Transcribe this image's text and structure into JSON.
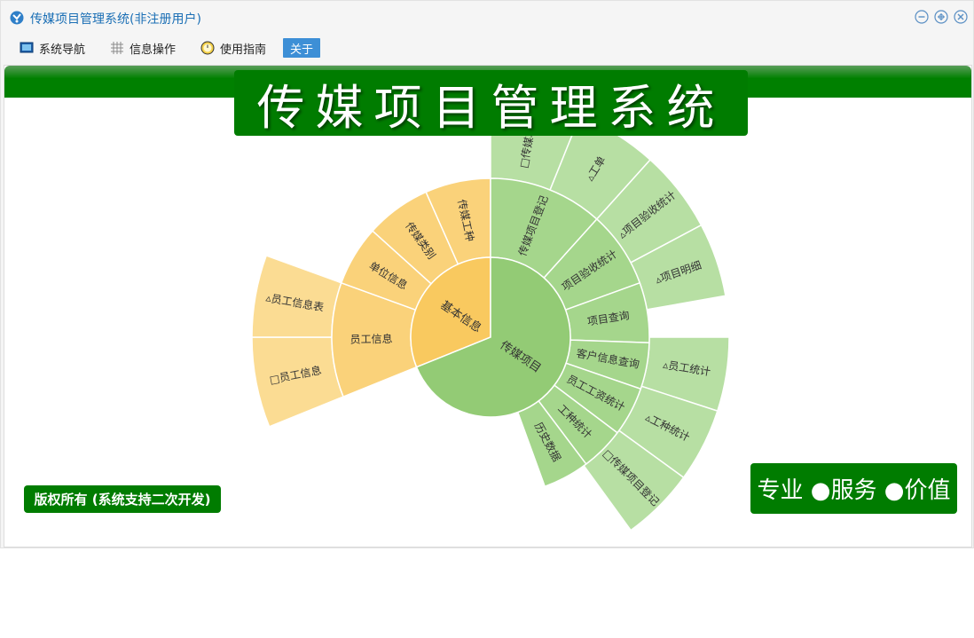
{
  "window": {
    "title": "传媒项目管理系统(非注册用户)"
  },
  "menu": {
    "items": [
      {
        "label": "系统导航",
        "icon": "monitor-icon"
      },
      {
        "label": "信息操作",
        "icon": "grid-icon"
      },
      {
        "label": "使用指南",
        "icon": "clock-icon"
      },
      {
        "label": "关于",
        "icon": ""
      }
    ]
  },
  "banner": {
    "title": "传媒项目管理系统"
  },
  "footer": {
    "copyright": "版权所有 (系统支持二次开发)",
    "slogan": "专业 ●服务 ●价值"
  },
  "colors": {
    "brand_green": "#007c00",
    "menu_active": "#3d8fd6",
    "yellow_inner": "#f9c95f",
    "yellow_mid": "#fad27a",
    "yellow_outer": "#fbdc93",
    "green_inner": "#93cb75",
    "green_mid": "#a5d68c",
    "green_outer": "#b7dfa3"
  },
  "chart_data": {
    "type": "sunburst",
    "center": "传媒项目",
    "groups": [
      {
        "name": "基本信息",
        "children": [
          {
            "name": "员工信息",
            "children": [
              {
                "name": "员工信息",
                "marker": "□"
              },
              {
                "name": "员工信息表",
                "marker": "▵"
              }
            ]
          },
          {
            "name": "单位信息",
            "children": []
          },
          {
            "name": "传媒类别",
            "children": []
          },
          {
            "name": "传媒工种",
            "children": []
          }
        ]
      },
      {
        "name": "传媒项目",
        "children": [
          {
            "name": "传媒项目登记",
            "children": [
              {
                "name": "传媒项目",
                "marker": "□"
              },
              {
                "name": "工单",
                "marker": "▵"
              }
            ]
          },
          {
            "name": "项目验收统计",
            "children": [
              {
                "name": "项目验收统计",
                "marker": "▵"
              },
              {
                "name": "项目明细",
                "marker": "▵"
              }
            ]
          },
          {
            "name": "项目查询",
            "children": []
          },
          {
            "name": "客户信息查询",
            "children": []
          },
          {
            "name": "员工工资统计",
            "children": [
              {
                "name": "员工统计",
                "marker": "▵"
              }
            ]
          },
          {
            "name": "工种统计",
            "children": [
              {
                "name": "工种统计",
                "marker": "▵"
              }
            ]
          },
          {
            "name": "历史数据",
            "children": [
              {
                "name": "传媒项目登记",
                "marker": "□"
              }
            ]
          }
        ]
      }
    ]
  }
}
